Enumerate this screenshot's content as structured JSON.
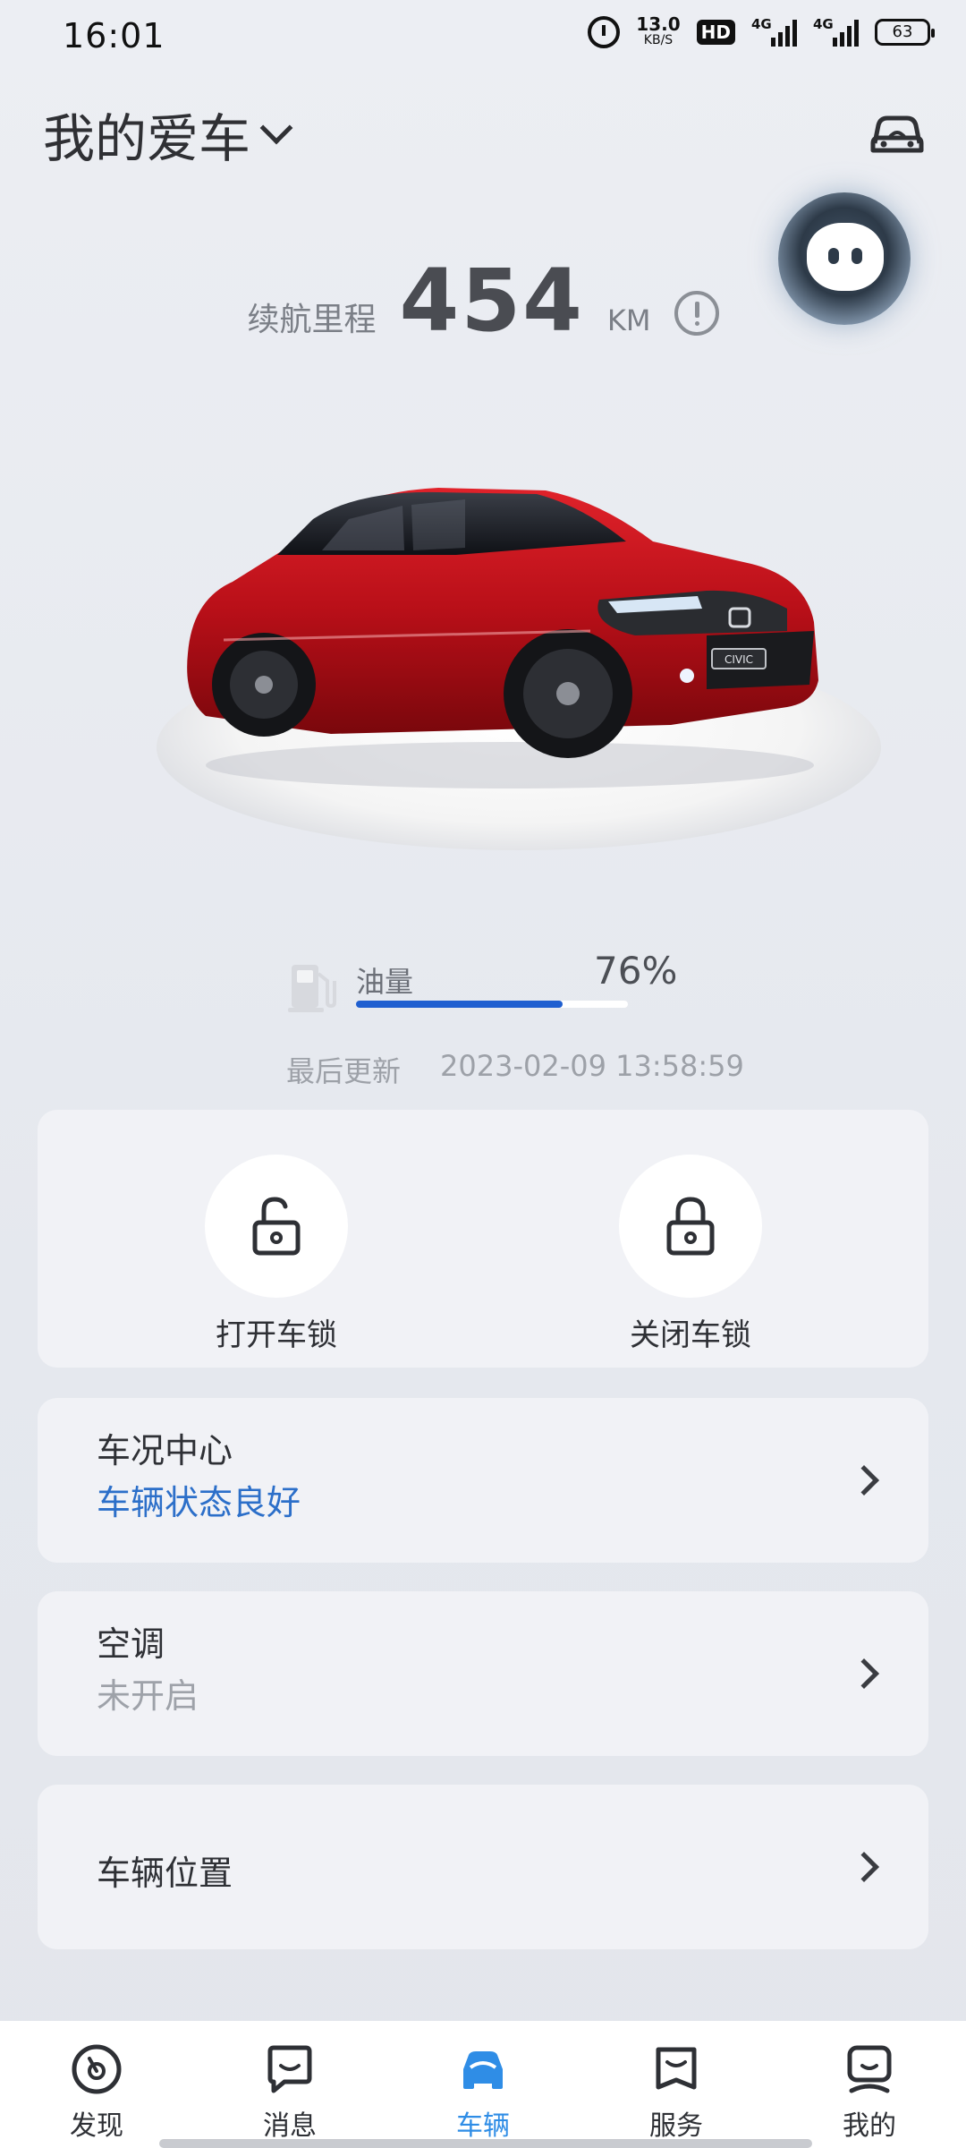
{
  "status_bar": {
    "time": "16:01",
    "net_speed_value": "13.0",
    "net_speed_unit": "KB/S",
    "hd_label": "HD",
    "sim1_label": "4G",
    "sim2_label": "4G",
    "battery": "63"
  },
  "header": {
    "title": "我的爱车",
    "dropdown_icon": "chevron-down-icon",
    "switch_icon": "car-front-icon"
  },
  "assistant": {
    "icon": "assistant-avatar-icon"
  },
  "range": {
    "label": "续航里程",
    "value": "454",
    "unit": "KM",
    "info_icon": "info-icon"
  },
  "vehicle": {
    "image": "car-image"
  },
  "fuel": {
    "label": "油量",
    "percent_text": "76%",
    "level": 0.76,
    "icon": "fuel-pump-icon",
    "bar_color": "#1f5fd0"
  },
  "last_update": {
    "label": "最后更新",
    "timestamp": "2023-02-09  13:58:59"
  },
  "locks": {
    "unlock_label": "打开车锁",
    "lock_label": "关闭车锁"
  },
  "status_center": {
    "title": "车况中心",
    "status": "车辆状态良好",
    "status_color": "#2c6fc9"
  },
  "ac": {
    "title": "空调",
    "status": "未开启",
    "status_color": "#9ea2a9"
  },
  "location": {
    "title": "车辆位置"
  },
  "tab_bar": {
    "tabs": [
      {
        "label": "发现",
        "icon": "discover-icon"
      },
      {
        "label": "消息",
        "icon": "message-icon"
      },
      {
        "label": "车辆",
        "icon": "vehicle-icon",
        "active": true
      },
      {
        "label": "服务",
        "icon": "service-icon"
      },
      {
        "label": "我的",
        "icon": "profile-icon"
      }
    ],
    "active_color": "#2f8de6"
  }
}
